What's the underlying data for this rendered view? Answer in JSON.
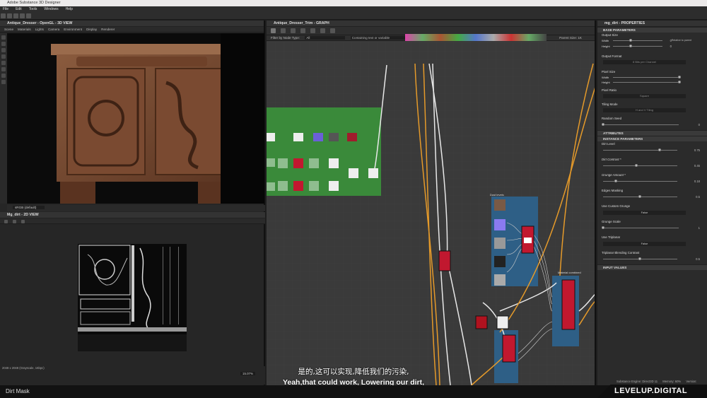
{
  "app_title": "Adobe Substance 3D Designer",
  "menu": [
    "File",
    "Edit",
    "Tools",
    "Windows",
    "Help"
  ],
  "view3d": {
    "title": "Antique_Dresser - OpenGL - 3D VIEW",
    "tabs": [
      "Scene",
      "Materials",
      "Lights",
      "Camera",
      "Environment",
      "Display",
      "Renderer"
    ],
    "colorspace": "sRGB (default)"
  },
  "view2d": {
    "title": "Mg_dirt - 2D VIEW",
    "status": "2048 x 2048 (Grayscale, 16bpc)",
    "zoom": "15.07%"
  },
  "graph": {
    "title": "Antique_Dresser_Trim - GRAPH",
    "filter_label": "Filter by Node Type:",
    "filter_value": "All",
    "search_placeholder": "Containing text or variable",
    "parent_size": "Parent Size: 1K",
    "frame1": "Dust levels",
    "frame2": "Material combined"
  },
  "properties": {
    "title": "mg_dirt - PROPERTIES",
    "base_section": "BASE PARAMETERS",
    "output_size": "Output Size",
    "width": "Width",
    "height": "Height",
    "width_val": "0",
    "height_val": "0",
    "relative": "Relative to parent",
    "output_format": "Output Format",
    "output_format_val": "8 Bits per Channel",
    "pixel_size": "Pixel Size",
    "pixel_ratio": "Pixel Ratio",
    "pixel_ratio_val": "Square",
    "tiling_mode": "Tiling Mode",
    "tiling_mode_val": "H and V Tiling",
    "random_seed": "Random Seed",
    "random_seed_val": "0",
    "attributes_section": "ATTRIBUTES",
    "instance_section": "INSTANCE PARAMETERS",
    "dirt_level": "Dirt Level",
    "dirt_level_val": "0.75",
    "dirt_contrast": "Dirt Contrast *",
    "dirt_contrast_val": "0.45",
    "grunge_amount": "Grunge Amount *",
    "grunge_amount_val": "0.18",
    "edges_masking": "Edges Masking",
    "edges_masking_val": "0.5",
    "use_custom_grunge": "Use Custom Grunge",
    "false1": "False",
    "grunge_scale": "Grunge Scale",
    "grunge_scale_val": "1",
    "use_triplanar": "Use Triplanar",
    "false2": "False",
    "triplanar_blend": "Triplanar Blending Contrast",
    "triplanar_blend_val": "0.5",
    "input_section": "INPUT VALUES"
  },
  "status": {
    "engine": "Substance Engine: Direct3D 11",
    "memory": "Memory: 60%",
    "version": "Version: 13.0.2"
  },
  "subtitle": {
    "zh": "是的,这可以实现,降低我们的污染,",
    "en": "Yeah,that could work, Lowering our dirt,"
  },
  "caption_left": "Dirt Mask",
  "watermark": "LEVELUP.DIGITAL",
  "colors": {
    "frame_green": "#3a8a3a",
    "frame_blue": "#2e5f86",
    "node_red": "#c1182f",
    "wire_orange": "#e59a2a"
  }
}
